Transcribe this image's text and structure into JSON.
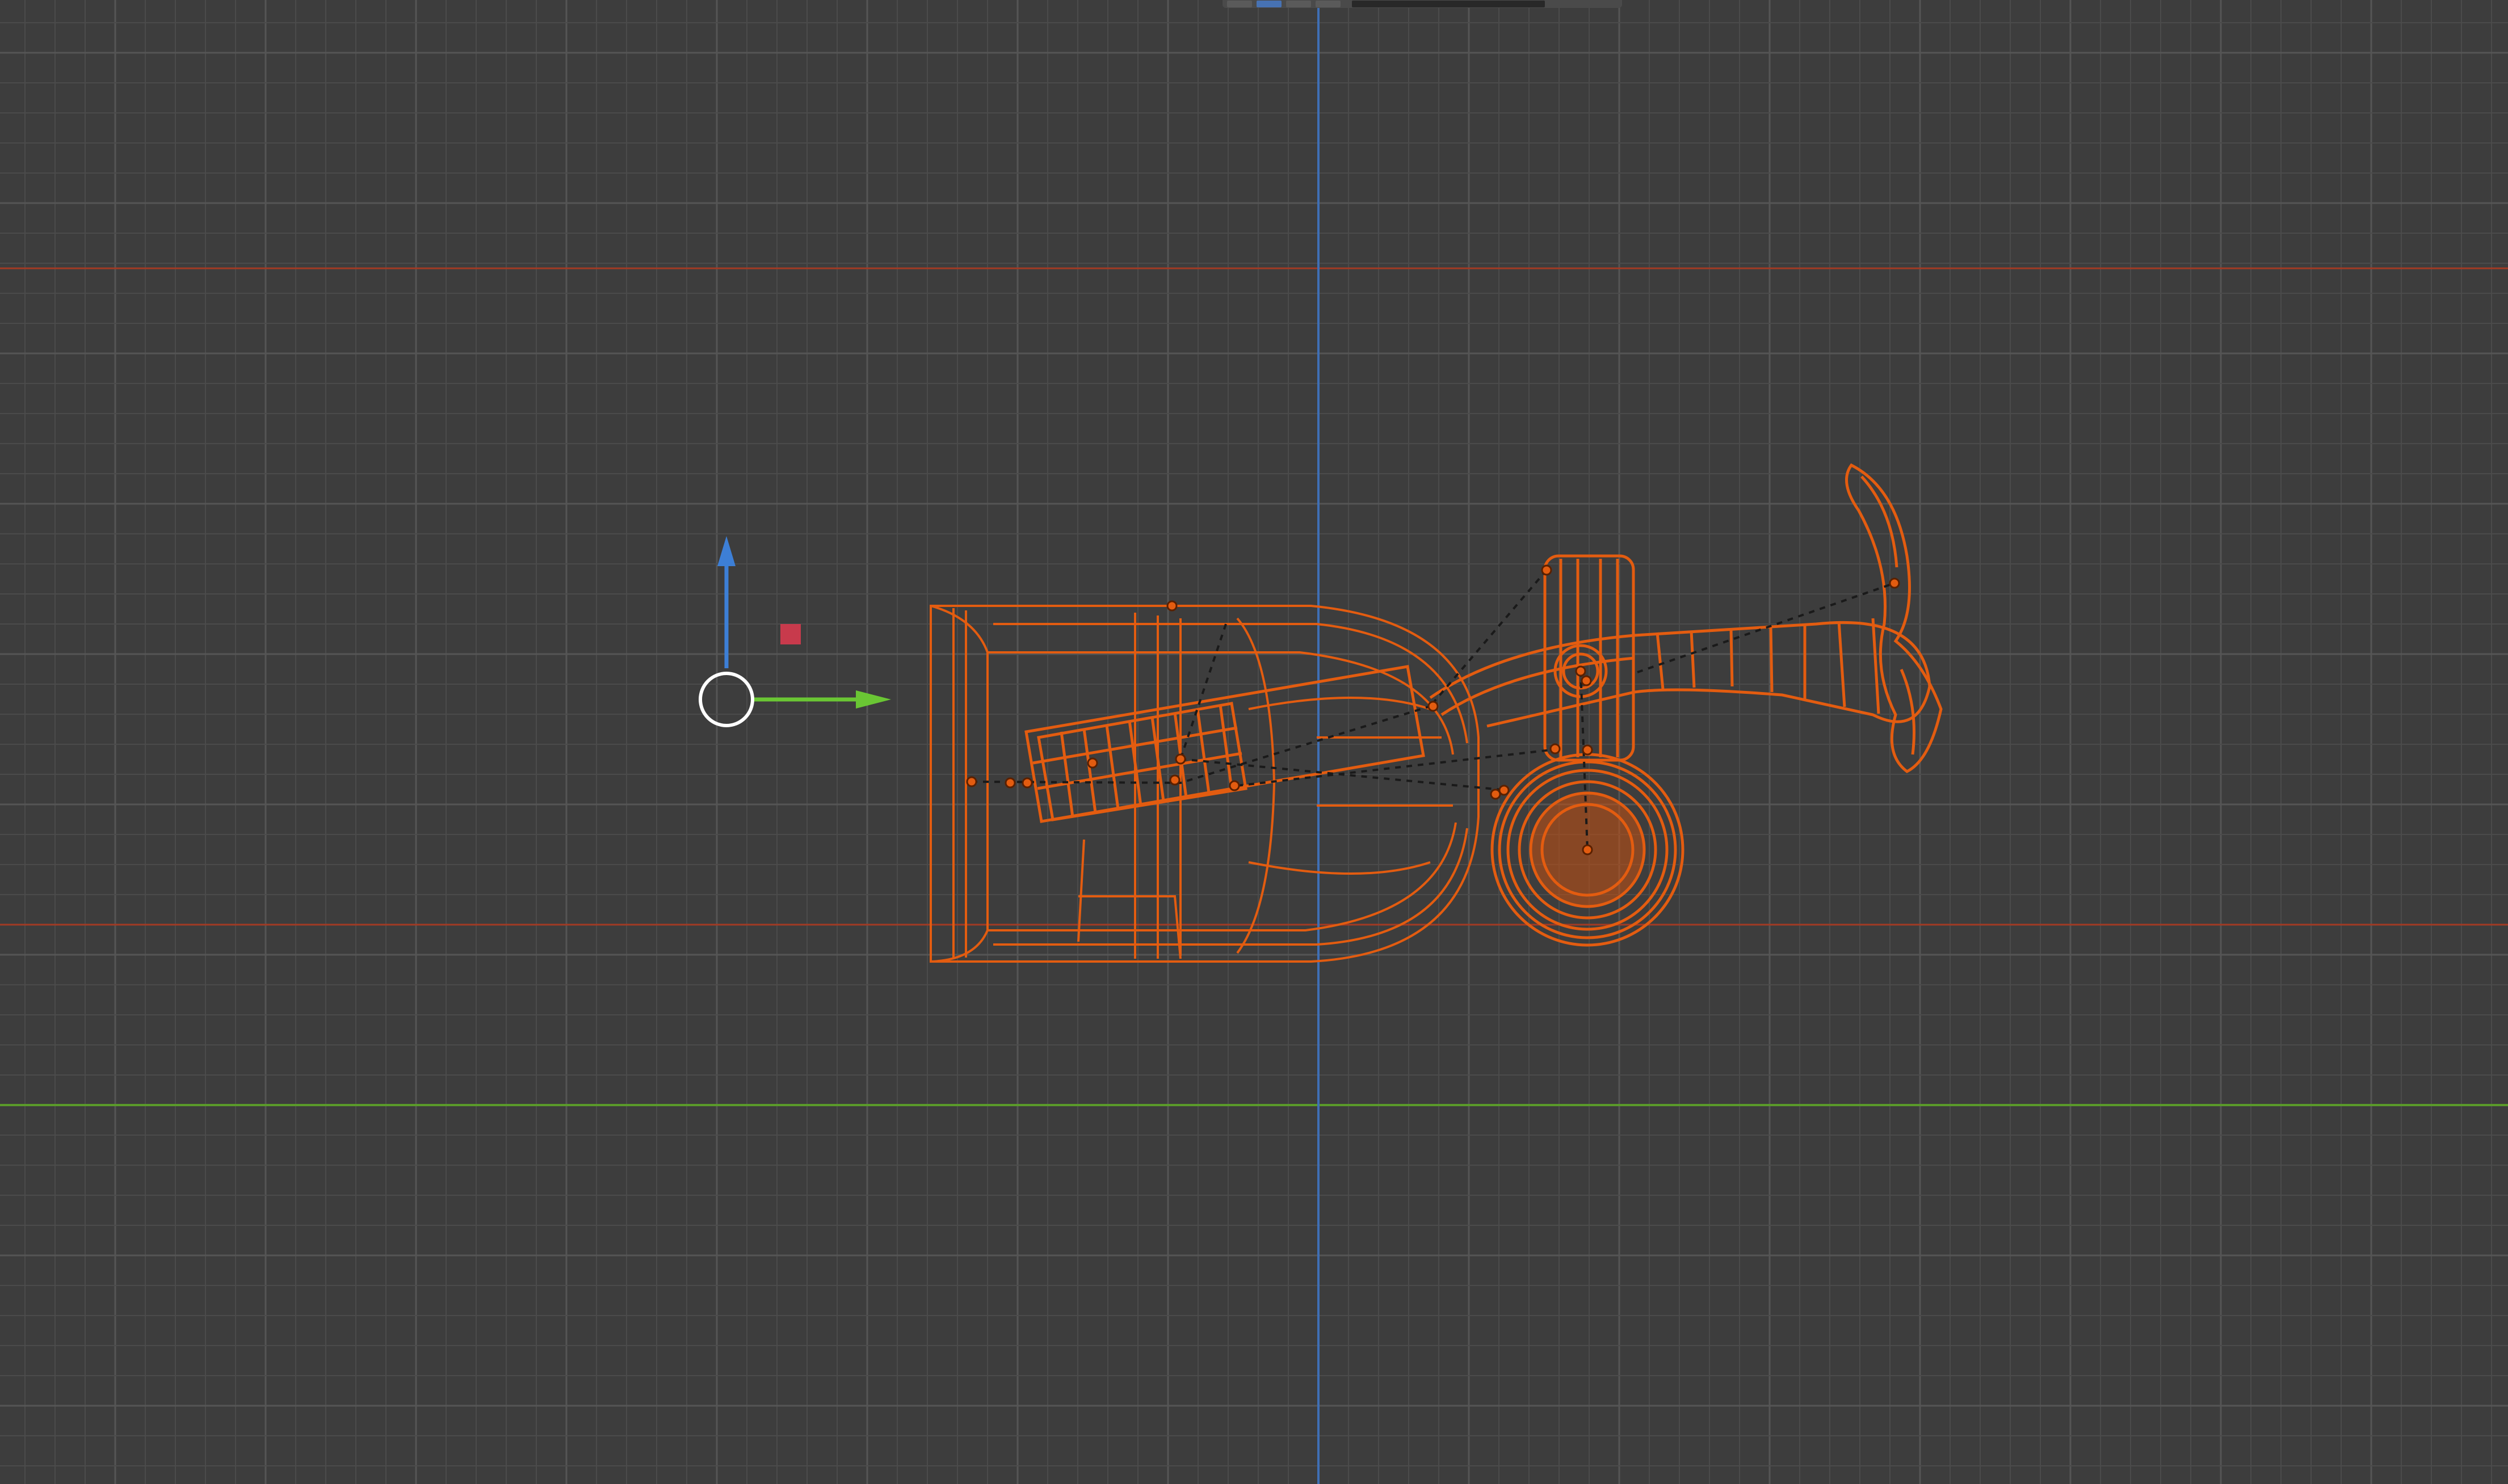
{
  "viewport": {
    "mode": "wireframe",
    "background_color": "#3d3d3d",
    "grid_color": "#4b4b4b",
    "grid_major_color": "#555555",
    "axis_x_color": "#a23a24",
    "axis_y_color": "#5a9a2a",
    "axis_z_color": "#3f6fb5",
    "selection_color": "#e35c10"
  },
  "header": {
    "icons": [
      "view-mode-icon",
      "overlay-icon",
      "shading-icon",
      "camera-icon"
    ]
  },
  "scene": {
    "selected_object": "bicycle-handle-assembly",
    "gizmo": {
      "z_axis_color": "#3d7fd6",
      "y_axis_color": "#6ac634",
      "center_color": "#ffffff",
      "handle_color": "#c83a4c"
    }
  }
}
